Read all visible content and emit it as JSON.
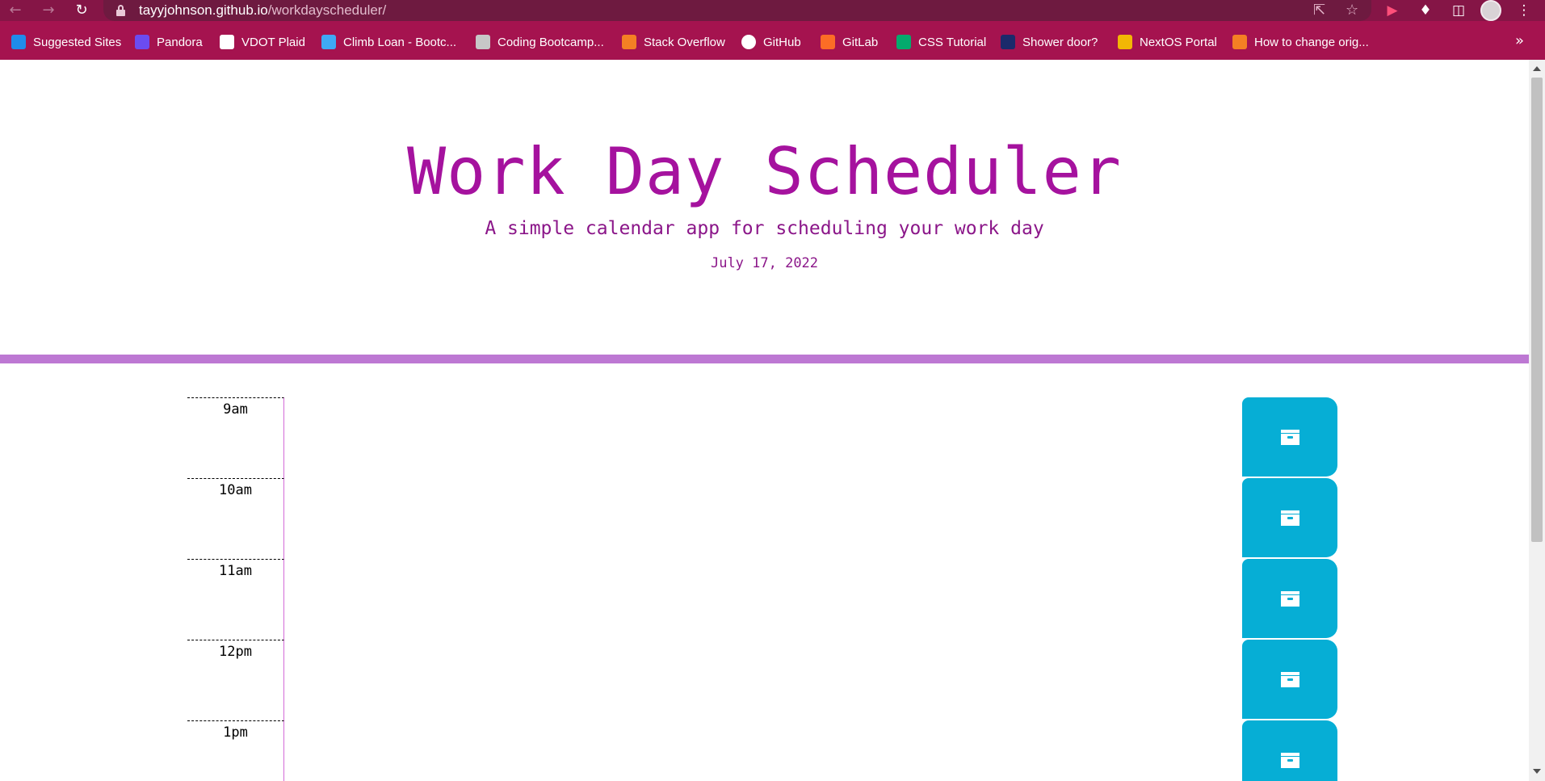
{
  "browser": {
    "url_host": "tayyjohnson.github.io",
    "url_path": "/workdayscheduler/",
    "bookmarks": [
      {
        "label": "Suggested Sites",
        "color": "#1f8ceb"
      },
      {
        "label": "Pandora",
        "color": "#6b4cf0"
      },
      {
        "label": "VDOT Plaid",
        "color": "#ffffff"
      },
      {
        "label": "Climb Loan - Bootc...",
        "color": "#3fa9f5"
      },
      {
        "label": "Coding Bootcamp...",
        "color": "#c7c7c7"
      },
      {
        "label": "Stack Overflow",
        "color": "#f48024"
      },
      {
        "label": "GitHub",
        "color": "#ffffff"
      },
      {
        "label": "GitLab",
        "color": "#fc6d26"
      },
      {
        "label": "CSS Tutorial",
        "color": "#04aa6d"
      },
      {
        "label": "Shower door?",
        "color": "#1b2a6b"
      },
      {
        "label": "NextOS Portal",
        "color": "#f2b705"
      },
      {
        "label": "How to change orig...",
        "color": "#f48024"
      }
    ]
  },
  "header": {
    "title": "Work Day Scheduler",
    "subtitle": "A simple calendar app for scheduling your work day",
    "current_date": "July 17, 2022"
  },
  "colors": {
    "title": "#a5129e",
    "divider": "#bd78d3",
    "save_button": "#06aed5",
    "chrome": "#a5134f"
  },
  "time_blocks": [
    {
      "hour": "9am",
      "text": ""
    },
    {
      "hour": "10am",
      "text": ""
    },
    {
      "hour": "11am",
      "text": ""
    },
    {
      "hour": "12pm",
      "text": ""
    },
    {
      "hour": "1pm",
      "text": ""
    }
  ]
}
